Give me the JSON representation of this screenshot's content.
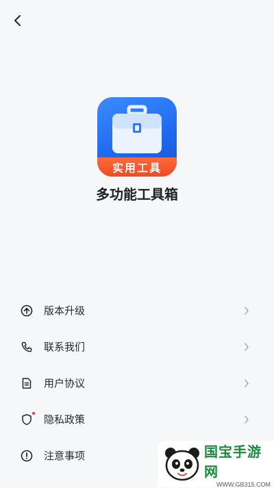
{
  "header": {
    "back_icon": "chevron-left-icon"
  },
  "app": {
    "logo_banner": "实用工具",
    "name": "多功能工具箱",
    "brand_color": "#1f6bf0",
    "banner_color": "#ee4a22"
  },
  "menu": {
    "items": [
      {
        "label": "版本升级",
        "icon": "upgrade-arrow-icon"
      },
      {
        "label": "联系我们",
        "icon": "phone-icon"
      },
      {
        "label": "用户协议",
        "icon": "document-icon"
      },
      {
        "label": "隐私政策",
        "icon": "shield-icon",
        "badge": true
      },
      {
        "label": "注意事项",
        "icon": "alert-icon"
      }
    ]
  },
  "watermark": {
    "title": "国宝手游网",
    "url": "WWW.GB315.COM",
    "color": "#1a8a3e"
  }
}
